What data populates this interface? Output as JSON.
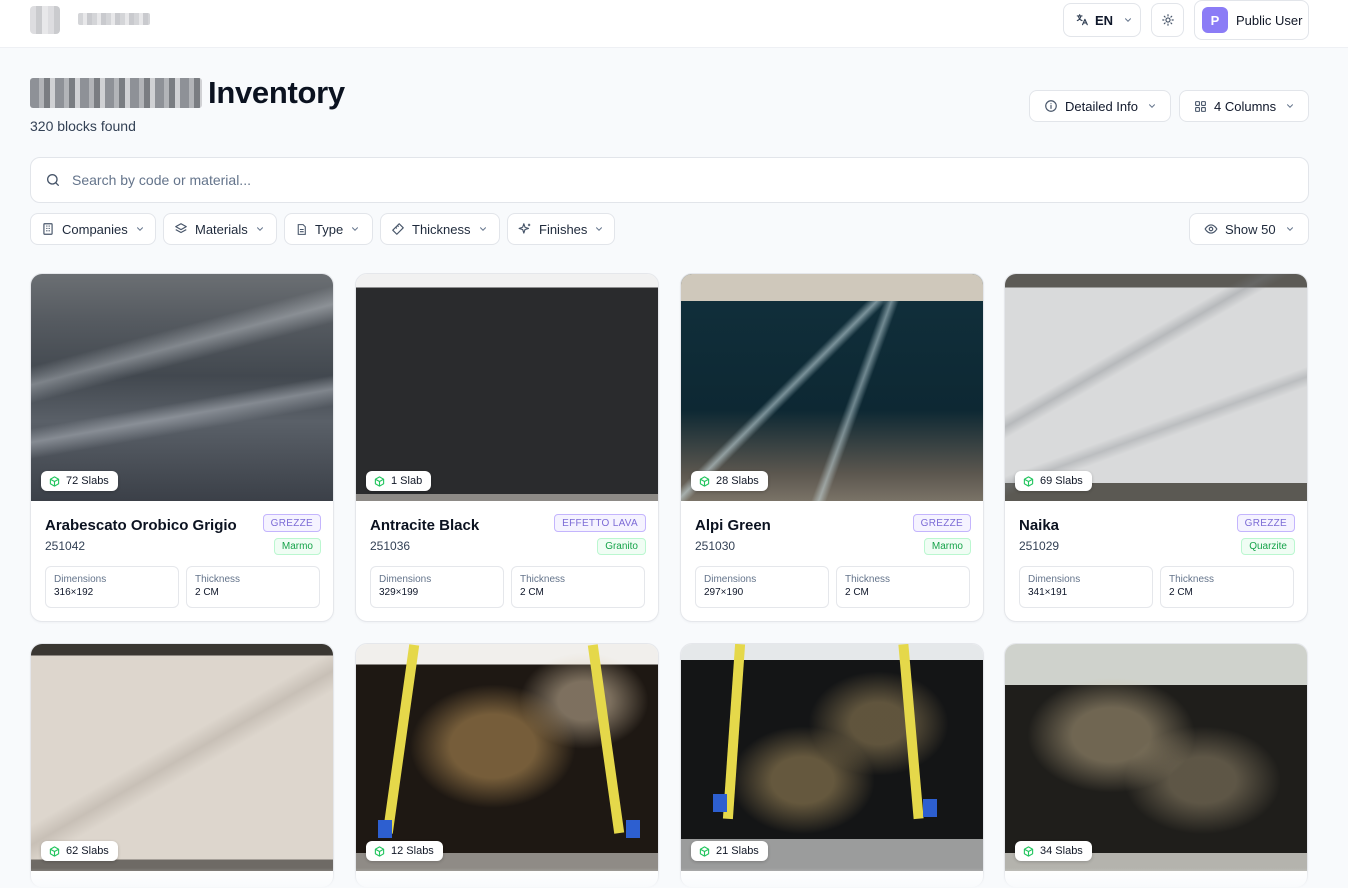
{
  "topbar": {
    "language": "EN",
    "user_initial": "P",
    "user_name": "Public User"
  },
  "header": {
    "title": "Inventory",
    "count_text": "320 blocks found",
    "detailed_info_label": "Detailed Info",
    "columns_label": "4 Columns"
  },
  "search": {
    "placeholder": "Search by code or material..."
  },
  "filters": {
    "companies": "Companies",
    "materials": "Materials",
    "type": "Type",
    "thickness": "Thickness",
    "finishes": "Finishes",
    "show": "Show 50"
  },
  "cards": [
    {
      "name": "Arabescato Orobico Grigio",
      "code": "251042",
      "finish": "GREZZE",
      "material": "Marmo",
      "slabs": "72 Slabs",
      "dimensions_label": "Dimensions",
      "dimensions": "316×192",
      "thickness_label": "Thickness",
      "thickness": "2 CM"
    },
    {
      "name": "Antracite Black",
      "code": "251036",
      "finish": "EFFETTO LAVA",
      "material": "Granito",
      "slabs": "1 Slab",
      "dimensions_label": "Dimensions",
      "dimensions": "329×199",
      "thickness_label": "Thickness",
      "thickness": "2 CM"
    },
    {
      "name": "Alpi Green",
      "code": "251030",
      "finish": "GREZZE",
      "material": "Marmo",
      "slabs": "28 Slabs",
      "dimensions_label": "Dimensions",
      "dimensions": "297×190",
      "thickness_label": "Thickness",
      "thickness": "2 CM"
    },
    {
      "name": "Naika",
      "code": "251029",
      "finish": "GREZZE",
      "material": "Quarzite",
      "slabs": "69 Slabs",
      "dimensions_label": "Dimensions",
      "dimensions": "341×191",
      "thickness_label": "Thickness",
      "thickness": "2 CM"
    },
    {
      "slabs": "62 Slabs"
    },
    {
      "slabs": "12 Slabs"
    },
    {
      "slabs": "21 Slabs"
    },
    {
      "slabs": "34 Slabs"
    }
  ],
  "colors": {
    "accent_avatar": "#8b7cf6",
    "finish_tag": "#7c6bd6",
    "material_tag": "#16a34a",
    "slab_badge_icon": "#22c55e"
  },
  "icons": [
    "translate-icon",
    "chevron-down-icon",
    "sun-icon",
    "info-icon",
    "grid-icon",
    "search-icon",
    "building-icon",
    "layers-icon",
    "document-icon",
    "ruler-icon",
    "sparkles-icon",
    "eye-icon",
    "box-icon"
  ]
}
